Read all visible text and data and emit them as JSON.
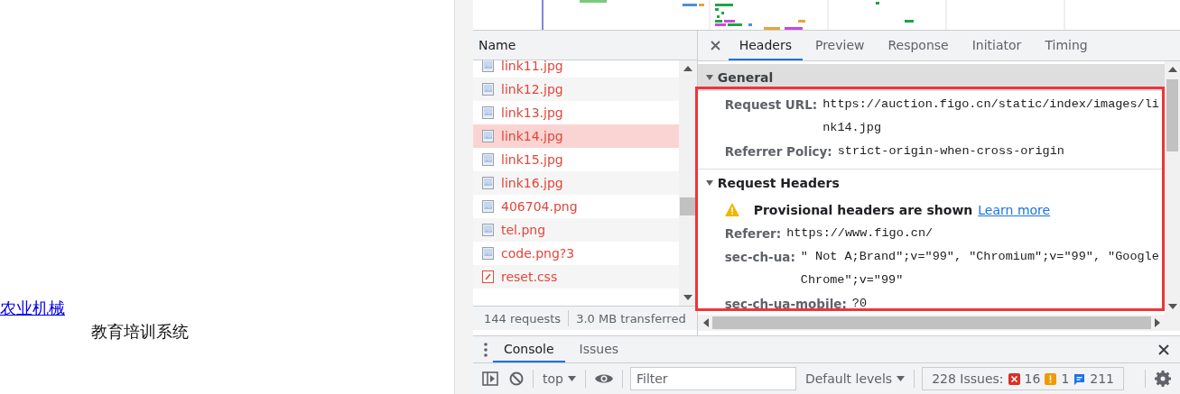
{
  "page": {
    "link": "农业机械",
    "text": "教育培训系统"
  },
  "network": {
    "name_header": "Name",
    "requests": [
      {
        "name": "link11.jpg",
        "kind": "image",
        "selected": false
      },
      {
        "name": "link12.jpg",
        "kind": "image",
        "selected": false
      },
      {
        "name": "link13.jpg",
        "kind": "image",
        "selected": false
      },
      {
        "name": "link14.jpg",
        "kind": "image",
        "selected": true
      },
      {
        "name": "link15.jpg",
        "kind": "image",
        "selected": false
      },
      {
        "name": "link16.jpg",
        "kind": "image",
        "selected": false
      },
      {
        "name": "406704.png",
        "kind": "image",
        "selected": false
      },
      {
        "name": "tel.png",
        "kind": "image",
        "selected": false
      },
      {
        "name": "code.png?3",
        "kind": "image",
        "selected": false
      },
      {
        "name": "reset.css",
        "kind": "stylesheet",
        "selected": false
      }
    ],
    "status": [
      "144 requests",
      "3.0 MB transferred"
    ]
  },
  "details": {
    "tabs": [
      {
        "label": "Headers",
        "selected": true
      },
      {
        "label": "Preview",
        "selected": false
      },
      {
        "label": "Response",
        "selected": false
      },
      {
        "label": "Initiator",
        "selected": false
      },
      {
        "label": "Timing",
        "selected": false
      }
    ],
    "sections": [
      {
        "title": "General",
        "expanded": true,
        "rows": [
          {
            "kind": "header",
            "name": "Request URL:",
            "value": "https://auction.figo.cn/static/index/images/link14.jpg"
          },
          {
            "kind": "header",
            "name": "Referrer Policy:",
            "value": "strict-origin-when-cross-origin"
          }
        ]
      },
      {
        "title": "Request Headers",
        "expanded": true,
        "rows": [
          {
            "kind": "warning",
            "name": "Provisional headers are shown",
            "value": "Learn more"
          },
          {
            "kind": "header",
            "name": "Referer:",
            "value": "https://www.figo.cn/"
          },
          {
            "kind": "header",
            "name": "sec-ch-ua:",
            "value": "\" Not A;Brand\";v=\"99\", \"Chromium\";v=\"99\", \"Google Chrome\";v=\"99\""
          },
          {
            "kind": "header",
            "name": "sec-ch-ua-mobile:",
            "value": "?0"
          }
        ]
      }
    ]
  },
  "drawer": {
    "tabs": [
      {
        "label": "Console",
        "selected": true
      },
      {
        "label": "Issues",
        "selected": false
      }
    ],
    "context": "top",
    "filter_placeholder": "Filter",
    "levels": "Default levels",
    "issues": {
      "label": "228 Issues:",
      "errors": "16",
      "warnings": "1",
      "infos": "211"
    }
  }
}
